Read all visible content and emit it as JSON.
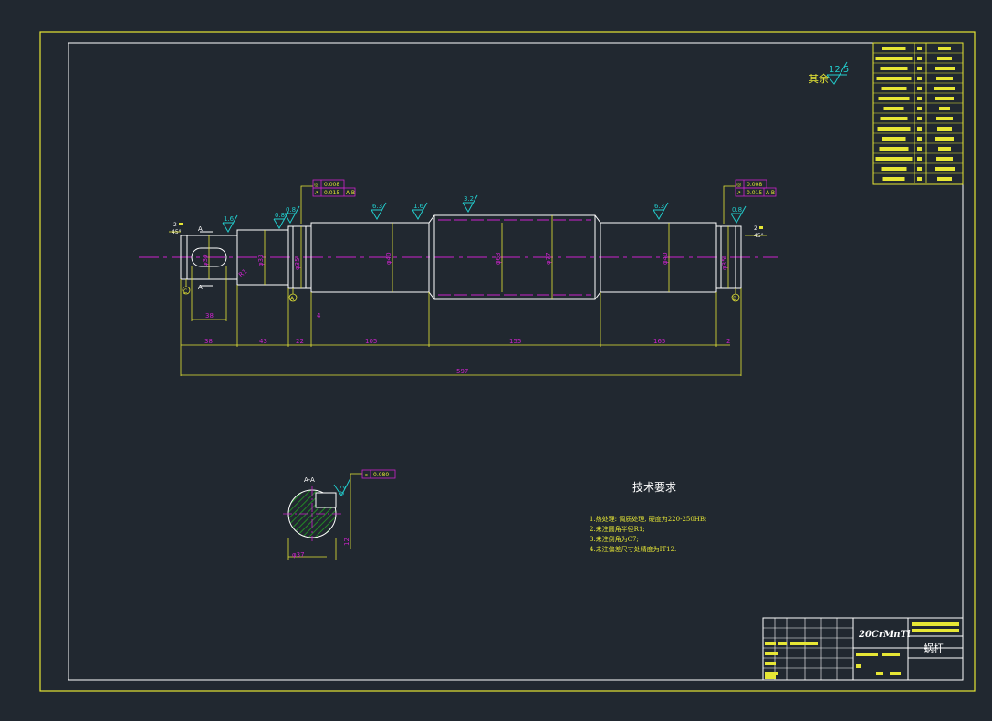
{
  "colors": {
    "background": "#212830",
    "frame": "#e6e635",
    "outline": "#ffffff",
    "dimension": "#e6e635",
    "centerline": "#cc22cc",
    "roughness": "#22cccc",
    "hatch": "#22aa22",
    "text_white": "#ffffff"
  },
  "main_view": {
    "section_labels": [
      "A",
      "A"
    ],
    "datum_labels": [
      "C",
      "A",
      "B"
    ],
    "roughness": {
      "rest": "12.5",
      "rest_label": "其余",
      "marks": [
        "1.6",
        "0.8",
        "6.3",
        "1.6",
        "3.2",
        "6.3",
        "0.8",
        "0.8"
      ]
    },
    "chamfer_left": {
      "size": "2",
      "angle": "45°"
    },
    "chamfer_right": {
      "size": "2",
      "angle": "45°"
    },
    "diameters": [
      "φ30",
      "φ33",
      "φ35",
      "φ40",
      "φ63",
      "φ77",
      "φ40",
      "φ35"
    ],
    "fcf_left": {
      "row1": [
        "◎",
        "0.008"
      ],
      "row2": [
        "↗",
        "0.015",
        "A-B"
      ]
    },
    "fcf_right": {
      "row1": [
        "◎",
        "0.008"
      ],
      "row2": [
        "↗",
        "0.015",
        "A-B"
      ]
    },
    "lengths": [
      "38",
      "43",
      "22",
      "105",
      "155",
      "165",
      "2"
    ],
    "total_length": "597",
    "keyway_length": "38",
    "small_dims": [
      "4",
      "R1"
    ]
  },
  "section_view": {
    "title": "A-A",
    "roughness": "3.2",
    "fcf": [
      "⌯",
      "0.080"
    ],
    "dia": "φ37",
    "depth": "12"
  },
  "tech_requirements": {
    "title": "技术要求",
    "items": [
      "1.热处理: 调质处理, 硬度为220-250HB;",
      "2.未注圆角半径R1;",
      "3.未注倒角为C7;",
      "4.未注偏差尺寸处精度为IT12."
    ]
  },
  "title_block": {
    "material": "20CrMnTi",
    "part_name": "蜗杆"
  }
}
